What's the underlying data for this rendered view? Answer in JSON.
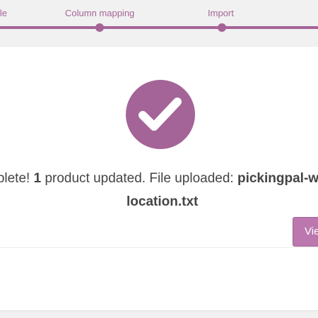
{
  "steps": {
    "upload_label": "ile",
    "mapping_label": "Column mapping",
    "import_label": "Import"
  },
  "message": {
    "prefix": "mplete! ",
    "count": "1",
    "middle": " product updated. File uploaded: ",
    "filename_part1": "pickingpal-w",
    "filename_part2": "location.txt"
  },
  "actions": {
    "view_label": "View products"
  },
  "colors": {
    "accent": "#a46497",
    "button": "#bb77ae",
    "text": "#444444"
  },
  "icons": {
    "success": "checkmark-icon"
  }
}
